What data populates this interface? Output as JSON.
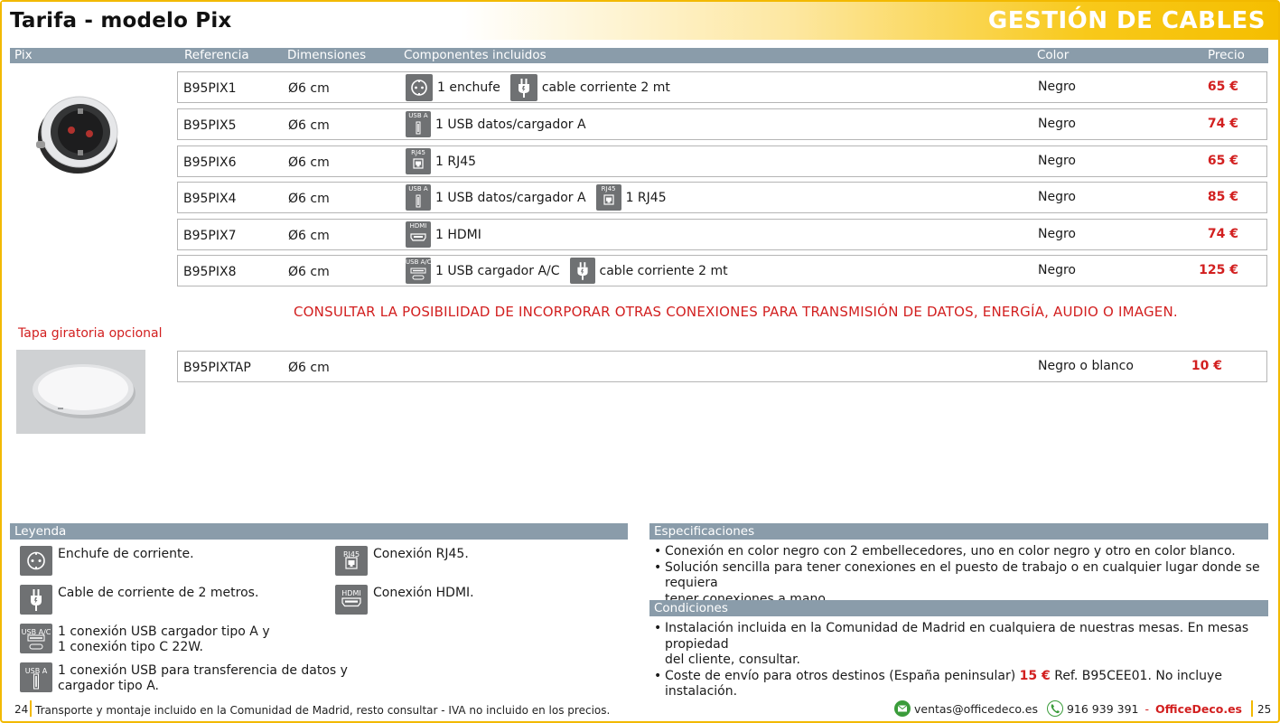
{
  "header": {
    "title": "Tarifa - modelo Pix",
    "section": "GESTIÓN DE CABLES"
  },
  "table_header": {
    "col_product": "Pix",
    "col_ref": "Referencia",
    "col_dim": "Dimensiones",
    "col_comp": "Componentes incluidos",
    "col_color": "Color",
    "col_price": "Precio"
  },
  "rows": [
    {
      "ref": "B95PIX1",
      "dim": "Ø6 cm",
      "comp1": "1 enchufe",
      "comp2": "cable corriente 2 mt",
      "color": "Negro",
      "price": "65 €"
    },
    {
      "ref": "B95PIX5",
      "dim": "Ø6 cm",
      "comp1": "1 USB datos/cargador A",
      "color": "Negro",
      "price": "74 €"
    },
    {
      "ref": "B95PIX6",
      "dim": "Ø6 cm",
      "comp1": "1 RJ45",
      "color": "Negro",
      "price": "65 €"
    },
    {
      "ref": "B95PIX4",
      "dim": "Ø6 cm",
      "comp1": "1 USB datos/cargador A",
      "comp2": "1 RJ45",
      "color": "Negro",
      "price": "85 €"
    },
    {
      "ref": "B95PIX7",
      "dim": "Ø6 cm",
      "comp1": "1 HDMI",
      "color": "Negro",
      "price": "74 €"
    },
    {
      "ref": "B95PIX8",
      "dim": "Ø6 cm",
      "comp1": "1 USB cargador A/C",
      "comp2": "cable corriente 2 mt",
      "color": "Negro",
      "price": "125 €"
    }
  ],
  "icon_labels": {
    "usb_a": "USB A",
    "rj45": "RJ45",
    "hdmi": "HDMI",
    "usb_ac": "USB A/C"
  },
  "notice": "CONSULTAR LA POSIBILIDAD DE INCORPORAR OTRAS CONEXIONES PARA TRANSMISIÓN DE DATOS, ENERGÍA, AUDIO O IMAGEN.",
  "tapa": {
    "label": "Tapa giratoria opcional",
    "ref": "B95PIXTAP",
    "dim": "Ø6 cm",
    "color": "Negro o blanco",
    "price": "10 €"
  },
  "legend": {
    "title": "Leyenda",
    "socket": "Enchufe de corriente.",
    "cable": "Cable de corriente de 2 metros.",
    "usb_ac_1": "1 conexión USB cargador tipo A y",
    "usb_ac_2": "1 conexión tipo C 22W.",
    "usb_a_1": "1 conexión USB para transferencia de datos y",
    "usb_a_2": "cargador tipo A.",
    "rj45": "Conexión RJ45.",
    "hdmi": "Conexión HDMI."
  },
  "specs": {
    "title": "Especificaciones",
    "b1": "Conexión en color negro con 2 embellecedores, uno en color negro y otro en color blanco.",
    "b2a": "Solución sencilla para tener conexiones en el puesto de trabajo o en cualquier lugar donde se requiera",
    "b2b": "tener conexiones a mano."
  },
  "conditions": {
    "title": "Condiciones",
    "b1a": "Instalación incluida en la Comunidad de Madrid en cualquiera de nuestras mesas. En mesas propiedad",
    "b1b": "del cliente, consultar.",
    "b2_pre": "Coste de envío para otros destinos (España peninsular)",
    "b2_price": "15 €",
    "b2_post": "Ref. B95CEE01. No incluye instalación."
  },
  "footer": {
    "page_left": "24",
    "page_right": "25",
    "text": "Transporte y montaje incluido en la Comunidad de Madrid, resto consultar - IVA no incluido en los precios.",
    "email": "ventas@officedeco.es",
    "phone": "916 939 391",
    "dash": "-",
    "brand": "OfficeDeco.es"
  },
  "colors": {
    "accent_yellow": "#f5be00",
    "bar_gray": "#8a9caa",
    "price_red": "#d21f1f",
    "icon_gray": "#6f7173"
  }
}
